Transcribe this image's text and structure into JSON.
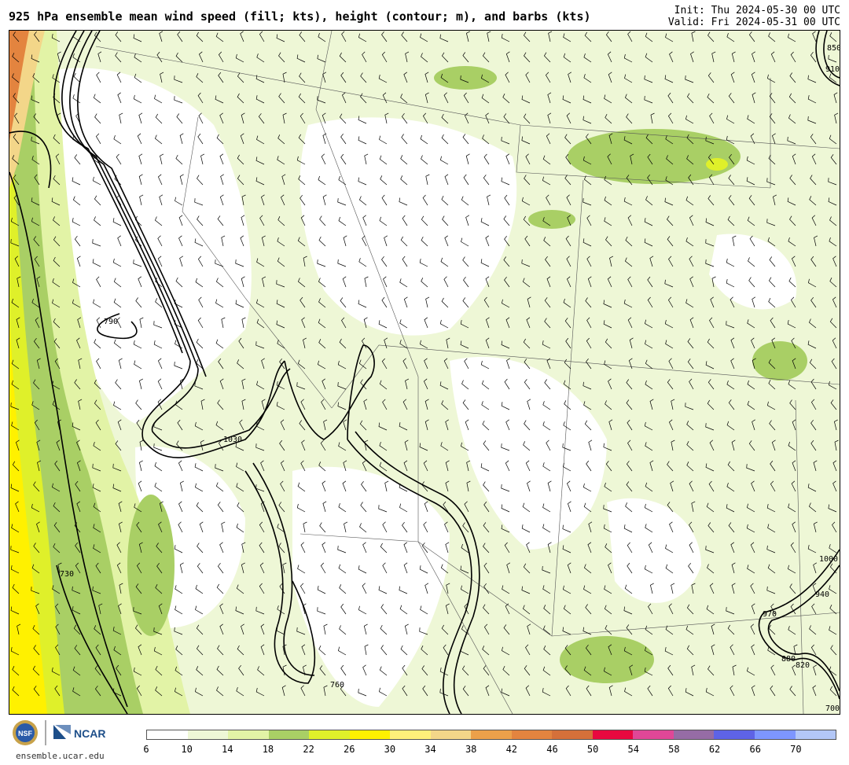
{
  "header": {
    "title": "925 hPa ensemble mean wind speed (fill; kts), height (contour; m), and barbs (kts)",
    "init": "Init: Thu 2024-05-30 00 UTC",
    "valid": "Valid: Fri 2024-05-31 00 UTC"
  },
  "map": {
    "contour_labels": [
      "790",
      "850",
      "910",
      "820",
      "970",
      "1030",
      "1000",
      "940",
      "880",
      "760",
      "730",
      "700"
    ],
    "colors": {
      "c6_10": "#ffffff",
      "c10_14": "#eef7d6",
      "c14_18": "#e2f3a6",
      "c18_22": "#a9cf65",
      "c22_26": "#dff02a",
      "c26_30": "#fff100",
      "contour": "#000000",
      "border": "#555555"
    }
  },
  "colorbar": {
    "ticks": [
      "6",
      "10",
      "14",
      "18",
      "22",
      "26",
      "30",
      "34",
      "38",
      "42",
      "46",
      "50",
      "54",
      "58",
      "62",
      "66",
      "70"
    ],
    "colors": [
      "#ffffff",
      "#eef7d6",
      "#e2f3a6",
      "#a9cf65",
      "#dff02a",
      "#fff100",
      "#fff07a",
      "#f3d689",
      "#eca04a",
      "#e3843f",
      "#d5703a",
      "#e8083f",
      "#e04797",
      "#966ca5",
      "#5e63e6",
      "#7d96ff",
      "#b3c7f7"
    ]
  },
  "footer": {
    "logo_nsf": "NSF",
    "logo_ncar": "NCAR",
    "site": "ensemble.ucar.edu"
  }
}
